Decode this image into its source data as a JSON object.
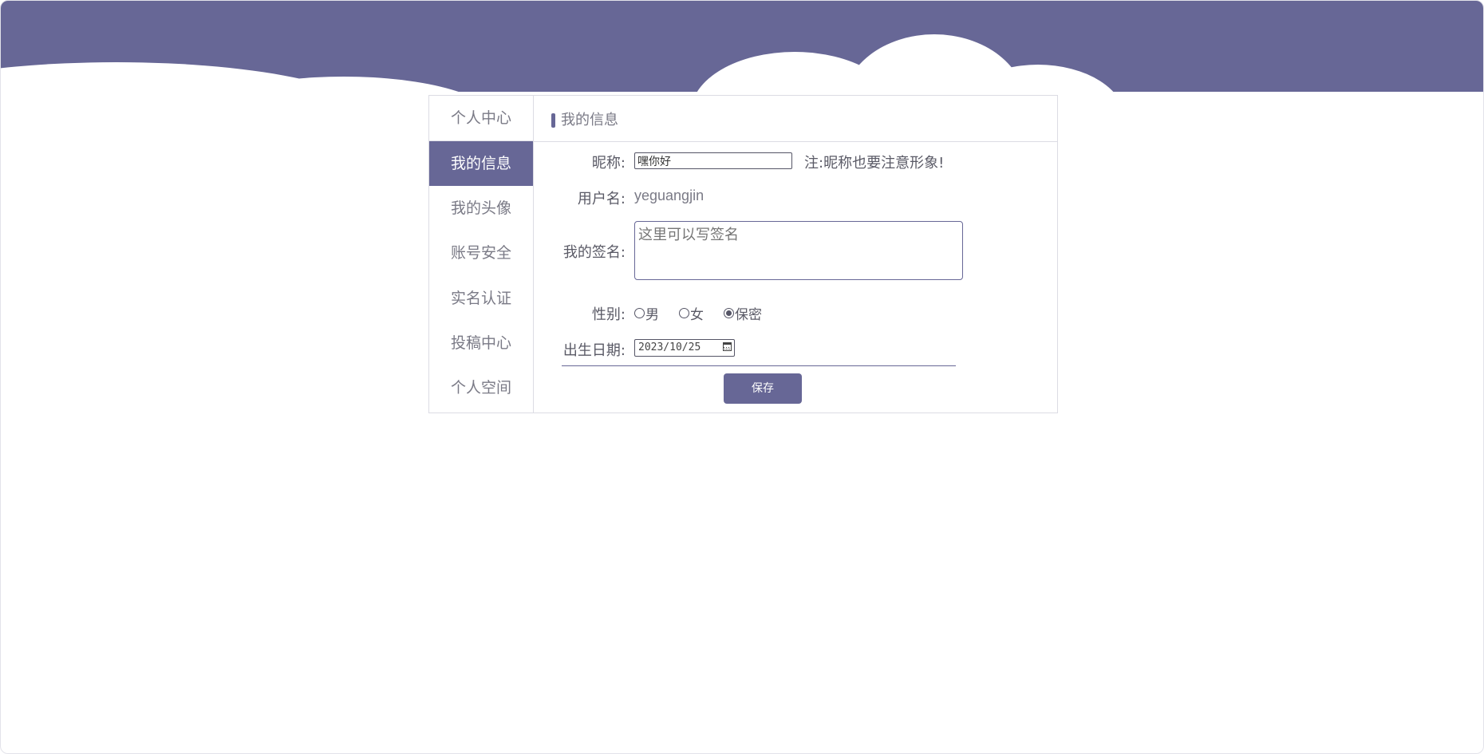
{
  "colors": {
    "accent": "#676796",
    "banner": "#676796",
    "text": "#5a5a66",
    "muted_text": "#7a7a86"
  },
  "sidebar": {
    "items": [
      {
        "label": "个人中心",
        "active": false
      },
      {
        "label": "我的信息",
        "active": true
      },
      {
        "label": "我的头像",
        "active": false
      },
      {
        "label": "账号安全",
        "active": false
      },
      {
        "label": "实名认证",
        "active": false
      },
      {
        "label": "投稿中心",
        "active": false
      },
      {
        "label": "个人空间",
        "active": false
      }
    ]
  },
  "content": {
    "title": "我的信息"
  },
  "form": {
    "nickname": {
      "label": "昵称:",
      "value": "嘿你好",
      "note": "注:昵称也要注意形象!"
    },
    "username": {
      "label": "用户名:",
      "value": "yeguangjin"
    },
    "signature": {
      "label": "我的签名:",
      "placeholder": "这里可以写签名"
    },
    "gender": {
      "label": "性别:",
      "options": [
        "男",
        "女",
        "保密"
      ],
      "selected": "保密"
    },
    "birthday": {
      "label": "出生日期:",
      "value": "2023/10/25",
      "icon": "calendar-icon"
    },
    "save_label": "保存"
  }
}
